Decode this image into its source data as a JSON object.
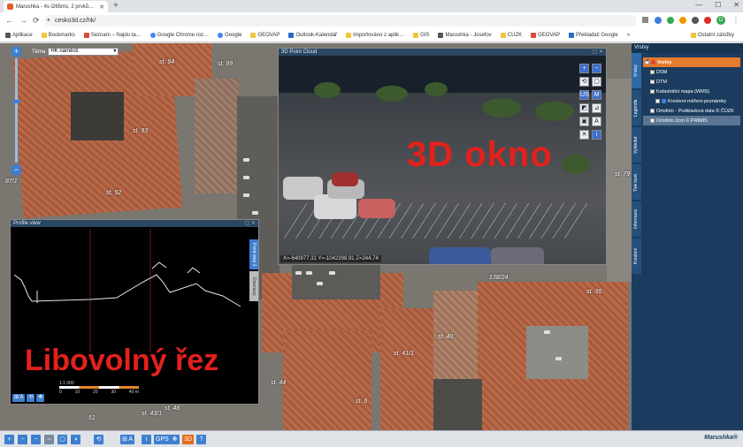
{
  "browser": {
    "tab_title": "Marushka - 4s i265ms, 2 prvků…",
    "new_tab": "+",
    "win_min": "—",
    "win_max": "☐",
    "win_close": "✕",
    "back": "←",
    "forward": "→",
    "reload": "⟳",
    "url": "cesko3d.cz/hk/",
    "profile": "O"
  },
  "bookmarks": {
    "items": [
      "Aplikace",
      "Bookmarks",
      "Seznam – Najdu ta…",
      "Google Chrome roz…",
      "Google",
      "GEOVAP",
      "Outlook-Kalendář",
      "Importováno z aplik…",
      "GIS",
      "Marushka - Josefov",
      "CUZK",
      "GEOVAP",
      "Překladač Google"
    ],
    "more": "»",
    "other": "Ostatní záložky"
  },
  "map": {
    "tema_label": "Téma",
    "tema_value": "HK náměstí",
    "scale_label": "87/1",
    "labels": [
      "st. 94",
      "st. 93",
      "st. 92",
      "st. 99",
      "st. 79",
      "st. 36",
      "st. 40",
      "138/24",
      "st. 41/1",
      "st. 44",
      "st. 43/1",
      "st. 48",
      "51",
      "st. 6"
    ]
  },
  "pointcloud": {
    "title": "3D Point Cloud",
    "overlay": "3D okno",
    "coords": "X=-640977.31 Y=-1042398.91 Z=244.74",
    "tools": [
      "+",
      "−",
      "⟲",
      "▢",
      "US",
      "M",
      "◩",
      "⊿",
      "▣",
      "A",
      "✕",
      "i"
    ]
  },
  "profile": {
    "title": "Profile view",
    "overlay": "Libovolný řez",
    "side_tabs": [
      "Point step 1",
      "Downsay"
    ],
    "scale_top": "1:1 000",
    "scale_ticks": [
      "0",
      "10",
      "20",
      "30",
      "40 m"
    ],
    "buttons": [
      "⊞ A",
      "⟲",
      "✥"
    ]
  },
  "panel": {
    "header": "Vrstvy",
    "tabs": [
      "Vrstvy",
      "Legenda",
      "Vyhledat",
      "Tisk kont.",
      "Informace",
      "Kreslení"
    ],
    "layers": [
      {
        "label": "Vrstvy",
        "header": true
      },
      {
        "label": "DSM"
      },
      {
        "label": "DTM"
      },
      {
        "label": "Katastrální mapa (WMS)"
      },
      {
        "label": "Kreslení-měření-poznámky"
      },
      {
        "label": "Ortofoto - Podkladová data © ČÚZK"
      },
      {
        "label": "Ortofoto 2cm © PRIMIS"
      }
    ]
  },
  "statusbar": {
    "buttons": [
      "+",
      "−",
      "−",
      "⇔",
      "▢",
      "◑",
      "⟲",
      "⊞ A",
      "i",
      "GPS",
      "✥",
      "3D",
      "?"
    ],
    "brand": "Marushka®"
  }
}
